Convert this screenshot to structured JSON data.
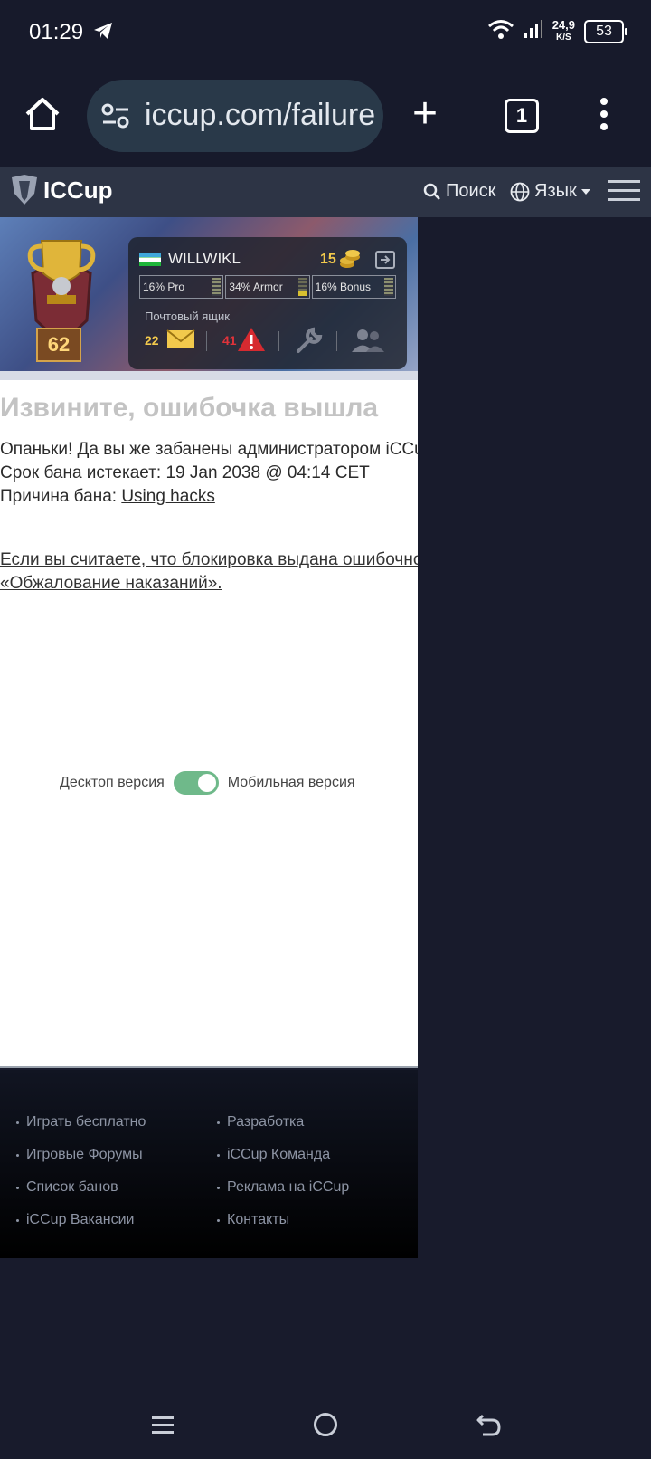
{
  "status": {
    "time": "01:29",
    "speed_top": "24,9",
    "speed_unit": "K/S",
    "battery": "53"
  },
  "browser": {
    "url": "iccup.com/failure",
    "tab_count": "1"
  },
  "site_nav": {
    "logo": "ICCup",
    "search": "Поиск",
    "language": "Язык"
  },
  "profile": {
    "level": "62",
    "username": "WILLWIKL",
    "coins": "15",
    "stats": [
      "16% Pro",
      "34% Armor",
      "16% Bonus"
    ],
    "mailbox_label": "Почтовый ящик",
    "mail_count": "22",
    "warnings": "41"
  },
  "error": {
    "title": "Извините, ошибочка вышла",
    "line1": "Опаньки! Да вы же забанены администратором iCCup.Paradise.",
    "line2": "Срок бана истекает: 19 Jan 2038 @ 04:14 CET",
    "reason_label": "Причина бана:",
    "reason": "Using hacks",
    "appeal_line1": "Если вы считаете, что блокировка выдана ошибочно — обратитесь в раздел",
    "appeal_line2": "«Обжалование наказаний»."
  },
  "version_toggle": {
    "desktop": "Десктоп версия",
    "mobile": "Мобильная версия",
    "mobile_selected": true
  },
  "footer": {
    "col1": [
      "Играть бесплатно",
      "Игровые Форумы",
      "Список банов",
      "iCCup Вакансии"
    ],
    "col2": [
      "Разработка",
      "iCCup Команда",
      "Реклама на iCCup",
      "Контакты"
    ]
  }
}
